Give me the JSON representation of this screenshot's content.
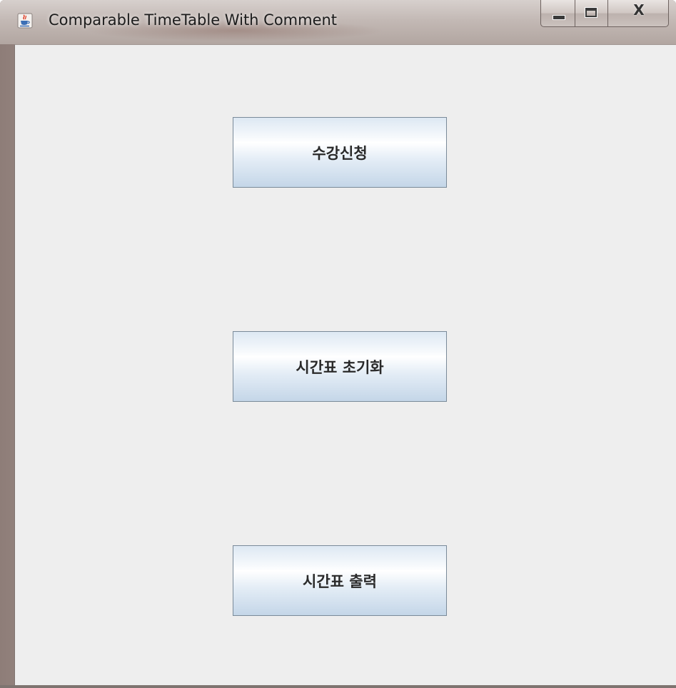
{
  "window": {
    "title": "Comparable TimeTable With Comment",
    "app_icon": "java-coffee-cup-icon",
    "controls": {
      "minimize": "minimize-icon",
      "maximize": "maximize-icon",
      "close_label": "X"
    }
  },
  "buttons": [
    {
      "label": "수강신청"
    },
    {
      "label": "시간표 초기화"
    },
    {
      "label": "시간표 출력"
    }
  ],
  "colors": {
    "client_background": "#eeeeee",
    "button_border": "#7a8a99",
    "button_gradient_top": "#dde8f3",
    "button_gradient_bottom": "#c4d6e8",
    "button_text": "#2a2a2a"
  }
}
